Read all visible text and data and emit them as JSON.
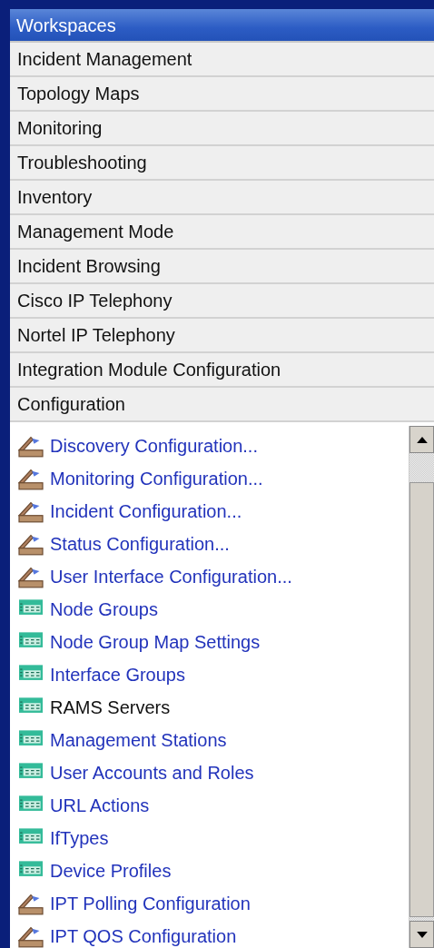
{
  "header": {
    "title": "Workspaces"
  },
  "workspaces": [
    {
      "label": "Incident Management"
    },
    {
      "label": "Topology Maps"
    },
    {
      "label": "Monitoring"
    },
    {
      "label": "Troubleshooting"
    },
    {
      "label": "Inventory"
    },
    {
      "label": "Management Mode"
    },
    {
      "label": "Incident Browsing"
    },
    {
      "label": "Cisco IP Telephony"
    },
    {
      "label": "Nortel IP Telephony"
    },
    {
      "label": "Integration Module Configuration"
    },
    {
      "label": "Configuration"
    }
  ],
  "items": [
    {
      "kind": "wizard",
      "label": "Discovery Configuration...",
      "color": "#2233bb"
    },
    {
      "kind": "wizard",
      "label": "Monitoring Configuration...",
      "color": "#2233bb"
    },
    {
      "kind": "wizard",
      "label": "Incident Configuration...",
      "color": "#2233bb"
    },
    {
      "kind": "wizard",
      "label": "Status Configuration...",
      "color": "#2233bb"
    },
    {
      "kind": "wizard",
      "label": "User Interface Configuration...",
      "color": "#2233bb"
    },
    {
      "kind": "table",
      "label": "Node Groups",
      "color": "#2233bb"
    },
    {
      "kind": "table",
      "label": "Node Group Map Settings",
      "color": "#2233bb"
    },
    {
      "kind": "table",
      "label": "Interface Groups",
      "color": "#2233bb"
    },
    {
      "kind": "table",
      "label": "RAMS Servers",
      "color": "#111111"
    },
    {
      "kind": "table",
      "label": "Management Stations",
      "color": "#2233bb"
    },
    {
      "kind": "table",
      "label": "User Accounts and Roles",
      "color": "#2233bb"
    },
    {
      "kind": "table",
      "label": "URL Actions",
      "color": "#2233bb"
    },
    {
      "kind": "table",
      "label": "IfTypes",
      "color": "#2233bb"
    },
    {
      "kind": "table",
      "label": "Device Profiles",
      "color": "#2233bb"
    },
    {
      "kind": "wizard",
      "label": "IPT Polling Configuration",
      "color": "#2233bb"
    },
    {
      "kind": "wizard",
      "label": "IPT QOS Configuration",
      "color": "#2233bb"
    }
  ]
}
